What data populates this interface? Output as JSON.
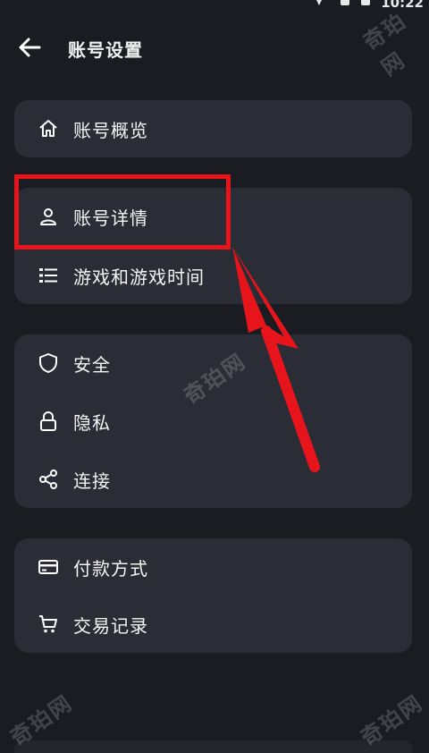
{
  "status_bar": {
    "time": "10:22"
  },
  "header": {
    "title": "账号设置"
  },
  "groups": [
    {
      "items": [
        {
          "label": "账号概览",
          "icon": "home-icon"
        }
      ]
    },
    {
      "items": [
        {
          "label": "账号详情",
          "icon": "person-icon"
        },
        {
          "label": "游戏和游戏时间",
          "icon": "list-icon"
        }
      ]
    },
    {
      "items": [
        {
          "label": "安全",
          "icon": "shield-icon"
        },
        {
          "label": "隐私",
          "icon": "lock-icon"
        },
        {
          "label": "连接",
          "icon": "share-icon"
        }
      ]
    },
    {
      "items": [
        {
          "label": "付款方式",
          "icon": "credit-card-icon"
        },
        {
          "label": "交易记录",
          "icon": "cart-icon"
        }
      ]
    }
  ],
  "watermark": "奇珀网",
  "colors": {
    "background": "#1a1c22",
    "card": "#2a2d35",
    "highlight": "#e8141b"
  }
}
